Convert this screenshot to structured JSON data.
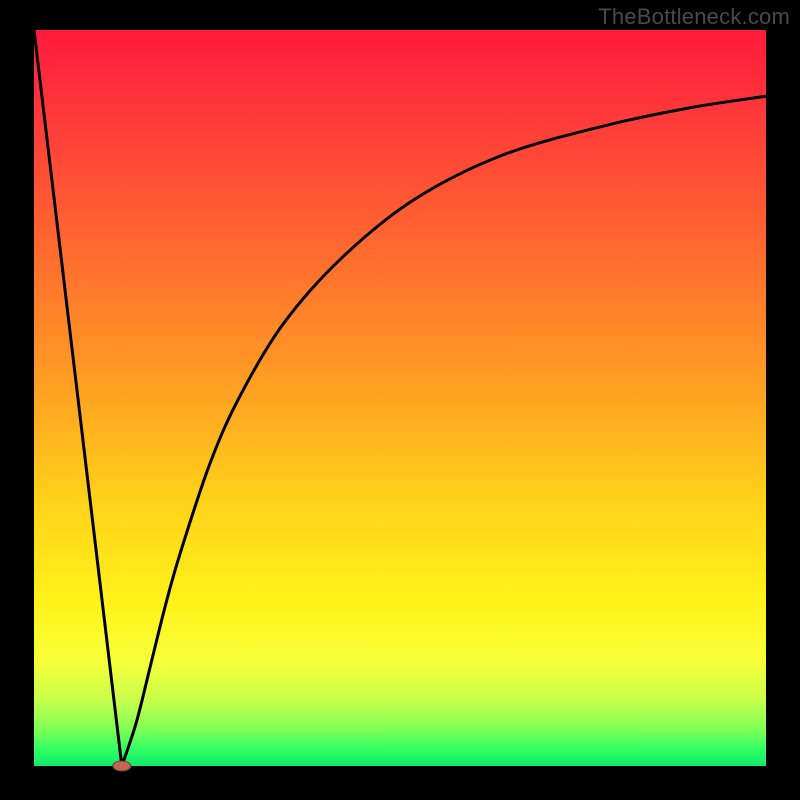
{
  "watermark": "TheBottleneck.com",
  "chart_data": {
    "type": "line",
    "title": "",
    "xlabel": "",
    "ylabel": "",
    "xlim": [
      0,
      100
    ],
    "ylim": [
      0,
      100
    ],
    "grid": false,
    "legend": false,
    "annotations": [],
    "series": [
      {
        "name": "left-descent",
        "x": [
          0,
          12
        ],
        "values": [
          100,
          0
        ]
      },
      {
        "name": "right-curve",
        "x": [
          12,
          14,
          16,
          18,
          20,
          24,
          28,
          34,
          42,
          52,
          64,
          78,
          90,
          100
        ],
        "values": [
          0,
          6,
          14,
          22,
          29,
          41,
          50,
          60,
          69,
          77,
          83,
          87,
          89.5,
          91
        ]
      }
    ],
    "marker": {
      "name": "minimum-marker",
      "x": 12,
      "y": 0,
      "color": "#c06a55",
      "rx": 9,
      "ry": 5
    }
  }
}
